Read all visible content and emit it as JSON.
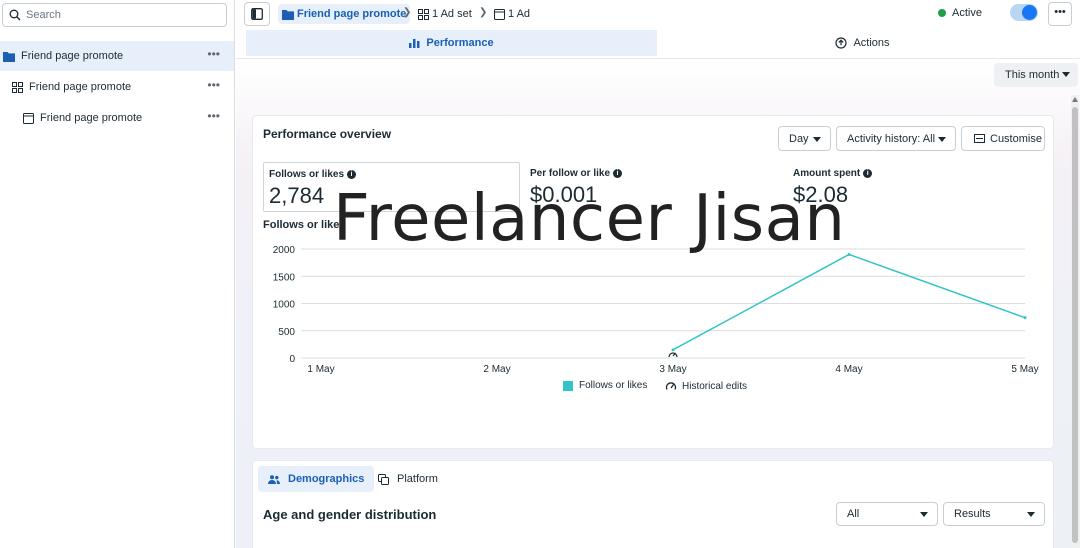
{
  "sidebar": {
    "search_placeholder": "Search",
    "items": [
      {
        "label": "Friend page promote",
        "icon": "folder-icon",
        "more": "•••"
      },
      {
        "label": "Friend page promote",
        "icon": "grid-icon",
        "more": "•••"
      },
      {
        "label": "Friend page promote",
        "icon": "ad-icon",
        "more": "•••"
      }
    ]
  },
  "header": {
    "breadcrumb": [
      {
        "label": "Friend page promote",
        "icon": "folder-icon"
      },
      {
        "label": "1 Ad set",
        "icon": "grid-icon"
      },
      {
        "label": "1 Ad",
        "icon": "ad-icon"
      }
    ],
    "status": "Active",
    "status_color": "#1e9e4a",
    "toggle_on": true,
    "more": "•••"
  },
  "tabs": {
    "performance": "Performance",
    "actions": "Actions"
  },
  "period": "This month",
  "overview": {
    "title": "Performance overview",
    "day": "Day",
    "history": "Activity history: All",
    "customise": "Customise",
    "metrics": [
      {
        "label": "Follows or likes",
        "value": "2,784"
      },
      {
        "label": "Per follow or like",
        "value": "$0.001"
      },
      {
        "label": "Amount spent",
        "value": "$2.08"
      }
    ],
    "chart_title": "Follows or likes",
    "legend": {
      "series": "Follows or likes",
      "edits": "Historical edits"
    }
  },
  "chart_data": {
    "type": "line",
    "categories": [
      "1 May",
      "2 May",
      "3 May",
      "4 May",
      "5 May"
    ],
    "series": [
      {
        "name": "Follows or likes",
        "values": [
          null,
          null,
          150,
          1900,
          740
        ]
      }
    ],
    "ylim": [
      0,
      2000
    ],
    "yticks": [
      0,
      500,
      1000,
      1500,
      2000
    ],
    "grid": true,
    "legend_position": "bottom-center",
    "color": "#35c4c6"
  },
  "watermark": "Freelancer Jisan",
  "demographics": {
    "tab_active": "Demographics",
    "tab_other": "Platform",
    "title": "Age and gender distribution",
    "filter_all": "All",
    "filter_results": "Results"
  }
}
